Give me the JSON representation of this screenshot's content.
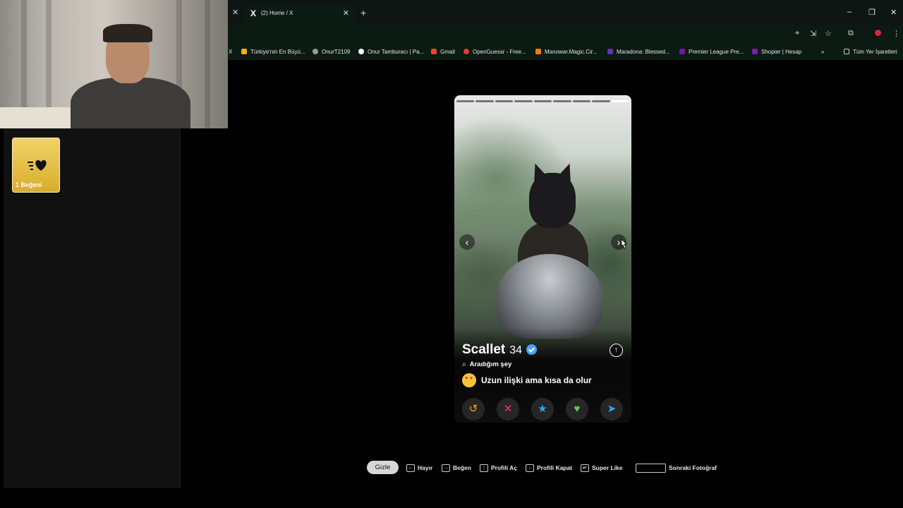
{
  "browser": {
    "tab_title": "(2) Home / X",
    "tab_logo": "X",
    "bookmarks": [
      {
        "label": "X",
        "color": "#000000"
      },
      {
        "label": "Türkiye'nin En Büyü...",
        "color": "#f2b01e"
      },
      {
        "label": "OnurT2109",
        "color": "#9a9a9a"
      },
      {
        "label": "Onur Tamburacı | Pa...",
        "color": "#ffffff"
      },
      {
        "label": "Gmail",
        "color": "#ea4335"
      },
      {
        "label": "OpenGuessr - Free...",
        "color": "#e53935"
      },
      {
        "label": "Manowar.Magic.Cir...",
        "color": "#f57c00"
      },
      {
        "label": "Maradona: Blessed...",
        "color": "#5e35b1"
      },
      {
        "label": "Premier League Pre...",
        "color": "#6a1b9a"
      },
      {
        "label": "Shopier | Hesap",
        "color": "#7b1fa2"
      },
      {
        "label": "Tüm Yer İşaretleri",
        "color": "#cfcfcf"
      }
    ]
  },
  "likes_card": {
    "label": "1 Beğeni",
    "icon": "fast-heart-icon"
  },
  "profile": {
    "name": "Scallet",
    "age": "34",
    "looking_for_label": "Aradığım şey",
    "goal_text": "Uzun ilişki ama kısa da olur",
    "photo_count": 9,
    "current_photo": 9
  },
  "actions": [
    {
      "name": "rewind-button",
      "icon": "rewind-icon",
      "glyph": "↺",
      "color": "#f5a623"
    },
    {
      "name": "nope-button",
      "icon": "x-icon",
      "glyph": "✕",
      "color": "#ff2d6f"
    },
    {
      "name": "super-like-button",
      "icon": "star-icon",
      "glyph": "★",
      "color": "#2aa7ff"
    },
    {
      "name": "like-button",
      "icon": "heart-icon",
      "glyph": "♥",
      "color": "#57d24b"
    },
    {
      "name": "boost-button",
      "icon": "send-icon",
      "glyph": "➤",
      "color": "#3aa9f0"
    }
  ],
  "shortcuts": {
    "hide": "Gizle",
    "no": "Hayır",
    "like": "Beğen",
    "open_profile": "Profili Aç",
    "close_profile": "Profili Kapat",
    "super_like": "Super Like",
    "next_photo": "Sonraki Fotoğraf"
  }
}
